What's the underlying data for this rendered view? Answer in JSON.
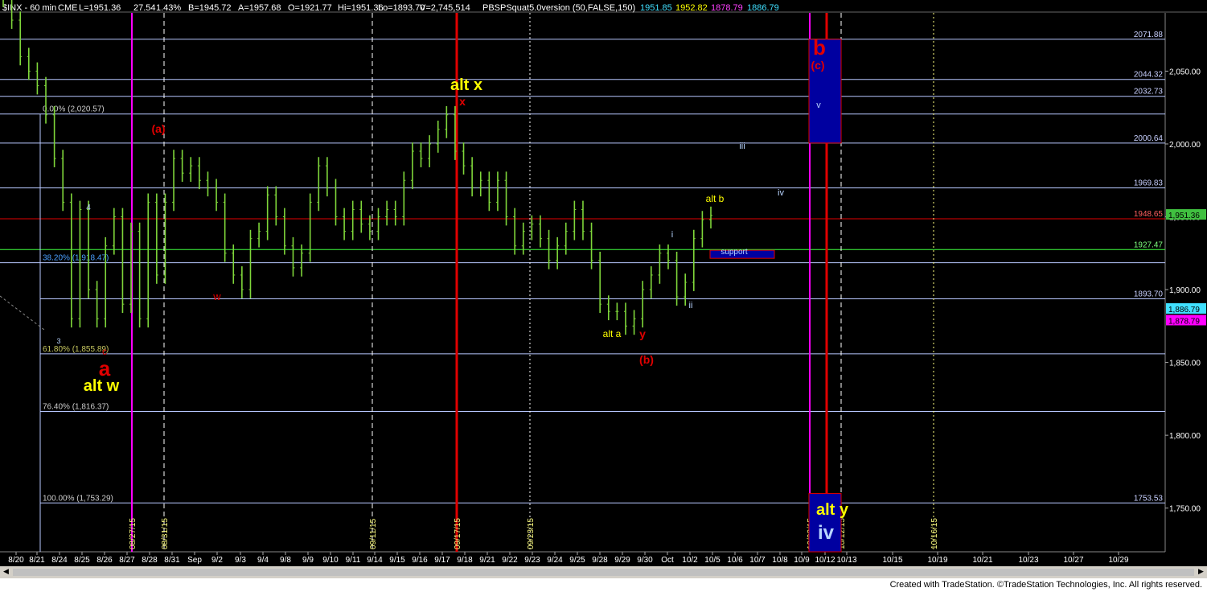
{
  "header": {
    "symbol": "$INX - 60 min",
    "exchange": "CME",
    "last": "L=1951.36",
    "change": "27.54",
    "pct": "1.43%",
    "b": "B=1945.72",
    "a": "A=1957.68",
    "o": "O=1921.77",
    "hi": "Hi=1951.36",
    "lo": "Lo=1893.70",
    "vol": "V=2,745,514",
    "indicator": "PBSPSquat5.0version (50,FALSE,150)",
    "ind_v1": "1951.85",
    "ind_v2": "1952.82",
    "ind_v3": "1878.79",
    "ind_v4": "1886.79"
  },
  "footer": "Created with TradeStation. ©TradeStation Technologies, Inc. All rights reserved.",
  "colors": {
    "bar": "#7fd63a",
    "red": "#e00000",
    "yellow": "#ffff00",
    "blue": "#0000a0",
    "magenta": "#ff00ff",
    "light_blue": "#b8d4ff"
  },
  "chart_data": {
    "type": "line",
    "title": "",
    "ylim": [
      1700,
      2100
    ],
    "y_ticks": [
      "1,750.00",
      "1,800.00",
      "1,850.00",
      "1,900.00",
      "1,950.00",
      "2,000.00",
      "2,050.00"
    ],
    "x_ticks": [
      "8/20",
      "8/21",
      "8/24",
      "8/25",
      "8/26",
      "8/27",
      "8/28",
      "8/31",
      "Sep",
      "9/2",
      "9/3",
      "9/4",
      "9/8",
      "9/9",
      "9/10",
      "9/11",
      "9/14",
      "9/15",
      "9/16",
      "9/17",
      "9/18",
      "9/21",
      "9/22",
      "9/23",
      "9/24",
      "9/25",
      "9/28",
      "9/29",
      "9/30",
      "Oct",
      "10/2",
      "10/5",
      "10/6",
      "10/7",
      "10/8",
      "10/9",
      "10/12",
      "10/13",
      "10/15",
      "10/19",
      "10/21",
      "10/23",
      "10/27",
      "10/29"
    ],
    "price_path": [
      2100,
      2085,
      2060,
      2050,
      2040,
      2020,
      1990,
      1960,
      1880,
      1955,
      1900,
      1880,
      1930,
      1950,
      1890,
      1940,
      1880,
      1960,
      1910,
      1960,
      1990,
      1980,
      1985,
      1975,
      1970,
      1960,
      1925,
      1910,
      1900,
      1935,
      1940,
      1965,
      1950,
      1930,
      1915,
      1925,
      1960,
      1985,
      1970,
      1950,
      1940,
      1955,
      1945,
      1940,
      1950,
      1955,
      1950,
      1975,
      1995,
      1990,
      2000,
      2010,
      2020,
      1995,
      1985,
      1970,
      1975,
      1960,
      1975,
      1950,
      1930,
      1940,
      1945,
      1935,
      1920,
      1930,
      1940,
      1955,
      1940,
      1920,
      1890,
      1885,
      1885,
      1875,
      1880,
      1900,
      1910,
      1925,
      1920,
      1895,
      1905,
      1935,
      1948,
      1951
    ],
    "series": [
      {
        "name": "Price",
        "values": [
          2100,
          2085,
          2060,
          2050,
          2040,
          2020,
          1990,
          1960,
          1880,
          1955,
          1900,
          1880,
          1930,
          1950,
          1890,
          1940,
          1880,
          1960,
          1910,
          1960,
          1990,
          1980,
          1985,
          1975,
          1970,
          1960,
          1925,
          1910,
          1900,
          1935,
          1940,
          1965,
          1950,
          1930,
          1915,
          1925,
          1960,
          1985,
          1970,
          1950,
          1940,
          1955,
          1945,
          1940,
          1950,
          1955,
          1950,
          1975,
          1995,
          1990,
          2000,
          2010,
          2020,
          1995,
          1985,
          1970,
          1975,
          1960,
          1975,
          1950,
          1930,
          1940,
          1945,
          1935,
          1920,
          1930,
          1940,
          1955,
          1940,
          1920,
          1890,
          1885,
          1885,
          1875,
          1880,
          1900,
          1910,
          1925,
          1920,
          1895,
          1905,
          1935,
          1948,
          1951
        ]
      }
    ],
    "hlines": [
      {
        "y": 2071.88,
        "label": "2071.88",
        "color": "#b8c8ff"
      },
      {
        "y": 2044.32,
        "label": "2044.32",
        "color": "#b8c8ff"
      },
      {
        "y": 2032.73,
        "label": "2032.73",
        "color": "#b8c8ff"
      },
      {
        "y": 2020.57,
        "label": "",
        "color": "#b8c8ff"
      },
      {
        "y": 2000.64,
        "label": "2000.64",
        "color": "#b8c8ff"
      },
      {
        "y": 1969.83,
        "label": "1969.83",
        "color": "#b8c8ff"
      },
      {
        "y": 1948.65,
        "label": "1948.65",
        "color": "#e00000"
      },
      {
        "y": 1927.47,
        "label": "1927.47",
        "color": "#40ff40"
      },
      {
        "y": 1918.47,
        "label": "",
        "color": "#b8c8ff"
      },
      {
        "y": 1893.7,
        "label": "1893.70",
        "color": "#b8c8ff"
      },
      {
        "y": 1855.89,
        "label": "",
        "color": "#b8c8ff"
      },
      {
        "y": 1816.37,
        "label": "",
        "color": "#b8c8ff"
      },
      {
        "y": 1753.53,
        "label": "1753.53",
        "color": "#b8c8ff"
      }
    ],
    "fib_labels": [
      {
        "text": "0.00% (2,020.57)",
        "y": 2020.57,
        "color": "#cccccc"
      },
      {
        "text": "38.20% (1,918.47)",
        "y": 1918.47,
        "color": "#4aa0ff"
      },
      {
        "text": "61.80% (1,855.89)",
        "y": 1855.89,
        "color": "#c8c860"
      },
      {
        "text": "76.40% (1,816.37)",
        "y": 1816.37,
        "color": "#cccccc"
      },
      {
        "text": "100.00% (1,753.29)",
        "y": 1753.29,
        "color": "#cccccc"
      }
    ],
    "price_tags": [
      {
        "text": "1,951.36",
        "y": 1951.36,
        "bg": "#40c040",
        "fg": "#000000"
      },
      {
        "text": "1,886.79",
        "y": 1886.79,
        "bg": "#40e0ff",
        "fg": "#000000"
      },
      {
        "text": "1,878.79",
        "y": 1878.79,
        "bg": "#ff00ff",
        "fg": "#000000"
      }
    ],
    "vlines": [
      {
        "x_tick": "8/27",
        "color": "#ff00ff",
        "style": "solid",
        "date": "08/27/15"
      },
      {
        "x_tick": "8/31",
        "color": "#ffffff",
        "style": "dashed",
        "date": "08/31/15"
      },
      {
        "x_tick": "9/14",
        "color": "#ffffff",
        "style": "dashed",
        "date": "09/11/15"
      },
      {
        "x_tick": "9/18",
        "color": "#e00000",
        "style": "solid",
        "date": "09/17/15"
      },
      {
        "x_tick": "9/22",
        "color": "#ffffff",
        "style": "dotted",
        "date": "09/23/15"
      },
      {
        "x_tick": "10/9",
        "color": "#ff00ff",
        "style": "solid",
        "date": "10/08/15"
      },
      {
        "x_tick": "10/12",
        "color": "#e00000",
        "style": "solid",
        "date": "10/12/15"
      },
      {
        "x_tick": "10/13",
        "color": "#ffffff",
        "style": "dashed",
        "date": "10/12/15"
      },
      {
        "x_tick": "10/19",
        "color": "#ffff80",
        "style": "dotted",
        "date": "10/16/15"
      }
    ],
    "annotations": [
      {
        "text": "(a)",
        "color": "#e00000",
        "size": 14
      },
      {
        "text": "alt x",
        "color": "#ffff00",
        "size": 20
      },
      {
        "text": "x",
        "color": "#e00000",
        "size": 14
      },
      {
        "text": "b",
        "color": "#e00000",
        "size": 26
      },
      {
        "text": "(c)",
        "color": "#e00000",
        "size": 14
      },
      {
        "text": "v",
        "color": "#b8d4ff",
        "size": 11
      },
      {
        "text": "iii",
        "color": "#b8d4ff",
        "size": 11
      },
      {
        "text": "iv",
        "color": "#b8d4ff",
        "size": 11
      },
      {
        "text": "alt b",
        "color": "#ffff00",
        "size": 12
      },
      {
        "text": "i",
        "color": "#b8d4ff",
        "size": 11
      },
      {
        "text": "support",
        "color": "#b8d4ff",
        "size": 10
      },
      {
        "text": "ii",
        "color": "#b8d4ff",
        "size": 11
      },
      {
        "text": "4",
        "color": "#b8d4ff",
        "size": 10
      },
      {
        "text": "w",
        "color": "#e00000",
        "size": 13
      },
      {
        "text": "alt a",
        "color": "#ffff00",
        "size": 12
      },
      {
        "text": "y",
        "color": "#e00000",
        "size": 14
      },
      {
        "text": "(b)",
        "color": "#e00000",
        "size": 14
      },
      {
        "text": "3",
        "color": "#b8d4ff",
        "size": 9
      },
      {
        "text": "c",
        "color": "#e00000",
        "size": 12
      },
      {
        "text": "a",
        "color": "#e00000",
        "size": 26
      },
      {
        "text": "alt w",
        "color": "#ffff00",
        "size": 20
      },
      {
        "text": "alt y",
        "color": "#ffff00",
        "size": 20
      },
      {
        "text": "iv",
        "color": "#b8d4ff",
        "size": 24
      }
    ]
  }
}
